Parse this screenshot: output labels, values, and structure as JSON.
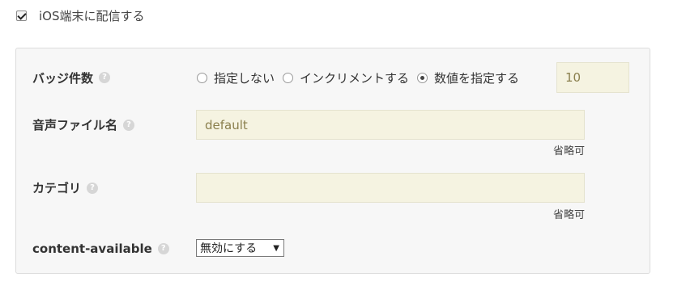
{
  "ios_toggle": {
    "label": "iOS端末に配信する",
    "checked": true
  },
  "badge": {
    "label": "バッジ件数",
    "help": "?",
    "options": [
      {
        "label": "指定しない",
        "checked": false
      },
      {
        "label": "インクリメントする",
        "checked": false
      },
      {
        "label": "数値を指定する",
        "checked": true
      }
    ],
    "value": "10"
  },
  "sound": {
    "label": "音声ファイル名",
    "help": "?",
    "value": "default",
    "note": "省略可"
  },
  "category": {
    "label": "カテゴリ",
    "help": "?",
    "value": "",
    "note": "省略可"
  },
  "content_available": {
    "label": "content-available",
    "help": "?",
    "selected": "無効にする",
    "arrow": "▼"
  }
}
